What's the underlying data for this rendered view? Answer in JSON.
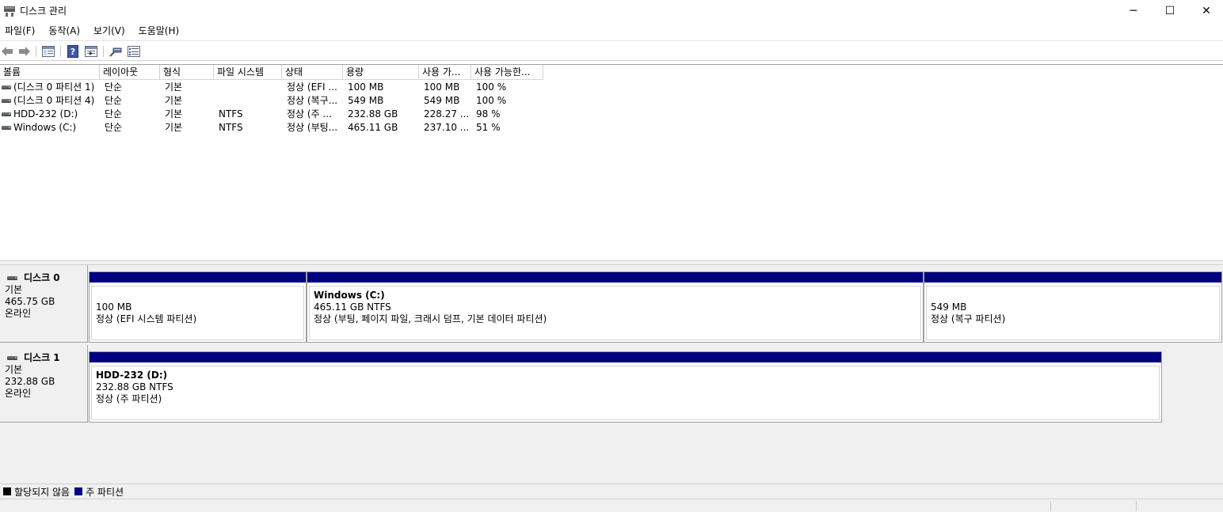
{
  "window": {
    "title": "디스크 관리",
    "minimize_glyph": "─",
    "maximize_glyph": "☐",
    "close_glyph": "✕"
  },
  "menu": [
    {
      "label": "파일(F)"
    },
    {
      "label": "동작(A)"
    },
    {
      "label": "보기(V)"
    },
    {
      "label": "도움말(H)"
    }
  ],
  "toolbar": {
    "icons": [
      "back-arrow-icon",
      "forward-arrow-icon",
      "console-tree-icon",
      "help-icon",
      "properties-icon",
      "connect-icon",
      "list-view-icon"
    ]
  },
  "volume_list": {
    "columns": [
      "볼륨",
      "레이아웃",
      "형식",
      "파일 시스템",
      "상태",
      "용량",
      "사용 가...",
      "사용 가능한..."
    ],
    "rows": [
      {
        "volume": "(디스크 0 파티션 1)",
        "layout": "단순",
        "type": "기본",
        "fs": "",
        "status": "정상 (EFI ...",
        "capacity": "100 MB",
        "free": "100 MB",
        "pct": "100 %"
      },
      {
        "volume": "(디스크 0 파티션 4)",
        "layout": "단순",
        "type": "기본",
        "fs": "",
        "status": "정상 (복구...",
        "capacity": "549 MB",
        "free": "549 MB",
        "pct": "100 %"
      },
      {
        "volume": "HDD-232 (D:)",
        "layout": "단순",
        "type": "기본",
        "fs": "NTFS",
        "status": "정상 (주 ...",
        "capacity": "232.88 GB",
        "free": "228.27 ...",
        "pct": "98 %"
      },
      {
        "volume": "Windows (C:)",
        "layout": "단순",
        "type": "기본",
        "fs": "NTFS",
        "status": "정상 (부팅...",
        "capacity": "465.11 GB",
        "free": "237.10 ...",
        "pct": "51 %"
      }
    ]
  },
  "disks": [
    {
      "name": "디스크 0",
      "type": "기본",
      "size": "465.75 GB",
      "state": "온라인",
      "partitions": [
        {
          "name": "",
          "size": "100 MB",
          "status": "정상 (EFI 시스템 파티션)"
        },
        {
          "name": "Windows  (C:)",
          "size": "465.11 GB NTFS",
          "status": "정상 (부팅, 페이지 파일, 크래시 덤프, 기본 데이터 파티션)"
        },
        {
          "name": "",
          "size": "549 MB",
          "status": "정상 (복구 파티션)"
        }
      ]
    },
    {
      "name": "디스크 1",
      "type": "기본",
      "size": "232.88 GB",
      "state": "온라인",
      "partitions": [
        {
          "name": "HDD-232  (D:)",
          "size": "232.88 GB NTFS",
          "status": "정상 (주 파티션)"
        }
      ]
    }
  ],
  "legend": [
    {
      "label": "할당되지 않음",
      "color": "#000000"
    },
    {
      "label": "주 파티션",
      "color": "#000080"
    }
  ],
  "colors": {
    "primary_partition": "#000080",
    "unallocated": "#000000"
  }
}
